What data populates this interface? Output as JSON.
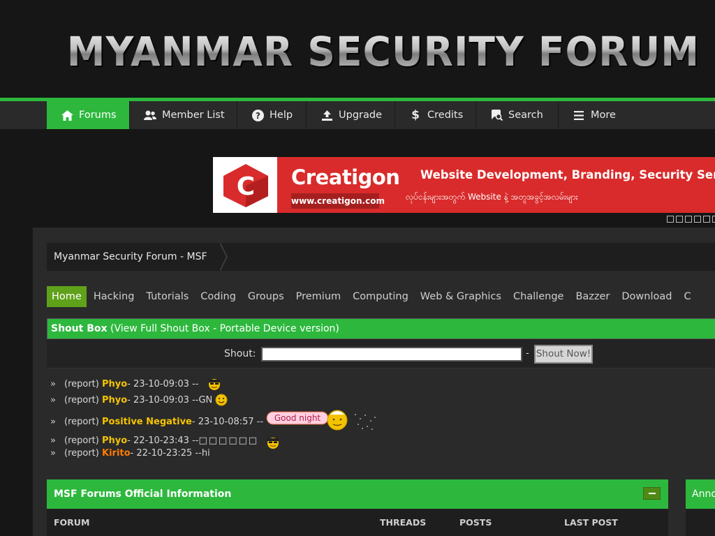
{
  "header": {
    "logo_text": "MYANMAR SECURITY FORUM"
  },
  "nav": {
    "items": [
      {
        "label": "Forums",
        "icon": "home-icon"
      },
      {
        "label": "Member List",
        "icon": "users-icon"
      },
      {
        "label": "Help",
        "icon": "question-icon"
      },
      {
        "label": "Upgrade",
        "icon": "upload-icon"
      },
      {
        "label": "Credits",
        "icon": "dollar-icon"
      },
      {
        "label": "Search",
        "icon": "search-chat-icon"
      },
      {
        "label": "More",
        "icon": "menu-icon"
      }
    ]
  },
  "banner": {
    "letter": "C",
    "brand": "Creatigon",
    "url": "www.creatigon.com",
    "headline": "Website Development, Branding, Security Services",
    "subline": "လုပ်ငန်းများအတွက် Website နဲ့ အတူအခွင့်အလမ်းများ"
  },
  "breadcrumb": {
    "label": "Myanmar Security Forum - MSF"
  },
  "subnav": [
    "Home",
    "Hacking",
    "Tutorials",
    "Coding",
    "Groups",
    "Premium",
    "Computing",
    "Web & Graphics",
    "Challenge",
    "Bazzer",
    "Download",
    "C"
  ],
  "shoutbox": {
    "title": "Shout Box",
    "subtitle": "(View Full Shout Box - Portable Device version)",
    "label": "Shout:",
    "dash": "-",
    "button": "Shout Now!",
    "raquo": "»",
    "entries": [
      {
        "report": "(report)",
        "user": "Phyo",
        "meta": " - 23-10-09:03 -- ",
        "msg": ""
      },
      {
        "report": "(report)",
        "user": "Phyo",
        "meta": " - 23-10-09:03 -- ",
        "msg": "GN"
      },
      {
        "report": "(report)",
        "user": "Positive Negative",
        "meta": " - 23-10-08:57 -- ",
        "msg": ""
      },
      {
        "report": "(report)",
        "user": "Phyo",
        "meta": " - 22-10-23:43 -- ",
        "msg": "□□□□□□"
      },
      {
        "report": "(report)",
        "user": "Kirito",
        "meta": " - 22-10-23:25 -- ",
        "msg": "hi"
      }
    ],
    "sticker_text": "Good night"
  },
  "forum": {
    "title": "MSF Forums Official Information",
    "columns": {
      "forum": "FORUM",
      "threads": "THREADS",
      "posts": "POSTS",
      "last_post": "LAST POST"
    }
  },
  "side": {
    "title": "Anno"
  },
  "colors": {
    "accent": "#2db83d",
    "user": "#f5c400",
    "user_alt": "#ff7a00"
  }
}
